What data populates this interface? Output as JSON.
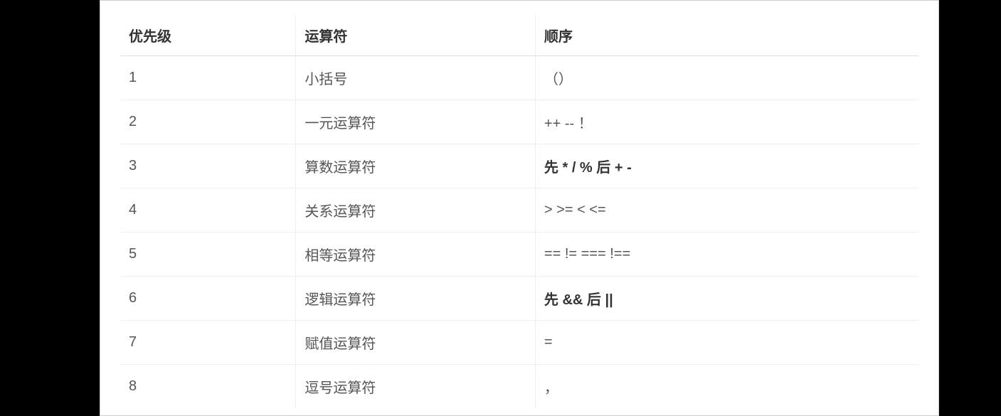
{
  "table": {
    "headers": [
      "优先级",
      "运算符",
      "顺序"
    ],
    "rows": [
      {
        "priority": "1",
        "operator": "小括号",
        "order": "（）",
        "bold": false
      },
      {
        "priority": "2",
        "operator": "一元运算符",
        "order": "++   --   ！",
        "bold": false
      },
      {
        "priority": "3",
        "operator": "算数运算符",
        "order": "先 * / %  后 + -",
        "bold": true
      },
      {
        "priority": "4",
        "operator": "关系运算符",
        "order": ">   >=   <   <=",
        "bold": false
      },
      {
        "priority": "5",
        "operator": "相等运算符",
        "order": "==   !=    ===    !==",
        "bold": false
      },
      {
        "priority": "6",
        "operator": "逻辑运算符",
        "order": "先 &&   后  ||",
        "bold": true
      },
      {
        "priority": "7",
        "operator": "赋值运算符",
        "order": "=",
        "bold": false
      },
      {
        "priority": "8",
        "operator": "逗号运算符",
        "order": "，",
        "bold": false
      }
    ]
  }
}
